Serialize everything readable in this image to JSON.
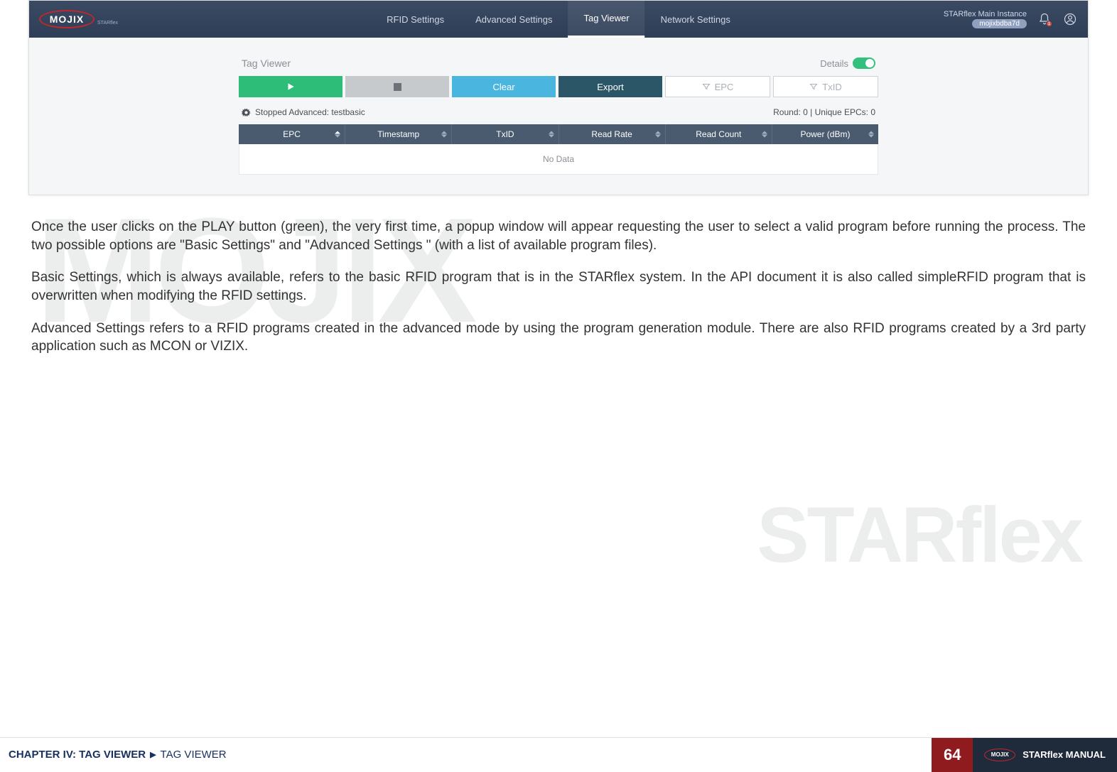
{
  "app": {
    "logo_text": "MOJIX",
    "logo_sub": "STARflex",
    "nav": [
      "RFID Settings",
      "Advanced Settings",
      "Tag Viewer",
      "Network Settings"
    ],
    "nav_active_index": 2,
    "instance_main": "STARflex Main Instance",
    "instance_badge": "mojixbdba7d",
    "bell_badge": "1"
  },
  "panel": {
    "title": "Tag Viewer",
    "details_label": "Details",
    "buttons": {
      "clear": "Clear",
      "export": "Export",
      "filter_epc": "EPC",
      "filter_txid": "TxID"
    },
    "status_left": "Stopped Advanced: testbasic",
    "status_right": "Round: 0 | Unique EPCs: 0",
    "columns": [
      "EPC",
      "Timestamp",
      "TxID",
      "Read Rate",
      "Read Count",
      "Power (dBm)"
    ],
    "nodata": "No Data"
  },
  "body": {
    "p1": "Once the user clicks on the PLAY button (green), the very first time, a popup window will appear requesting  the user to select a valid program before running the process. The two possible options are \"Basic Settings\" and \"Advanced Settings \" (with a list of available program files).",
    "p2": "Basic Settings, which is always available, refers to the basic RFID program that is in the STARflex system. In the API document it is also called simpleRFID program that is overwritten when modifying the RFID settings.",
    "p3": "Advanced Settings refers to a RFID programs created in the advanced mode by using the program generation module. There are also RFID programs created by a 3rd party application such as MCON or VIZIX."
  },
  "footer": {
    "chapter": "CHAPTER IV: TAG VIEWER",
    "sub": "TAG VIEWER",
    "page": "64",
    "manual": "STARflex MANUAL",
    "mini_logo": "MOJIX"
  },
  "watermark": {
    "mojix": "MOJIX",
    "starflex": "STARflex"
  }
}
